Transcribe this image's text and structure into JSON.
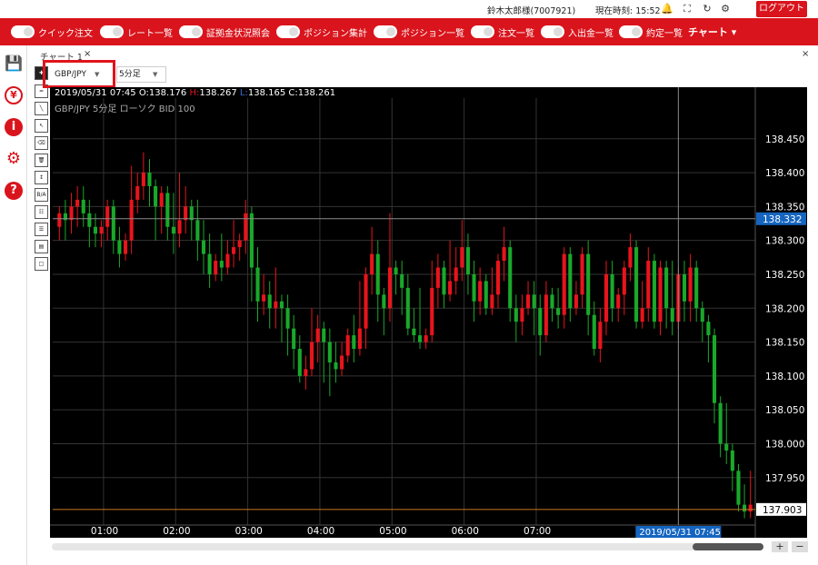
{
  "topbar": {
    "user": "鈴木太郎様(7007921)",
    "time_label": "現在時刻: 15:52",
    "logout": "ログアウト",
    "icons": [
      "bell-icon",
      "fullscreen-icon",
      "refresh-icon",
      "gear-icon"
    ]
  },
  "menu": {
    "items": [
      "クイック注文",
      "レート一覧",
      "証拠金状況照会",
      "ポジション集計",
      "ポジション一覧",
      "注文一覧",
      "入出金一覧",
      "約定一覧"
    ],
    "chart_label": "チャート"
  },
  "sidebar": {
    "icons": [
      "save-icon",
      "yen-icon",
      "info-icon",
      "gear-icon",
      "help-icon"
    ]
  },
  "panel": {
    "title": "チャート 1",
    "close": "×",
    "window_close": "×"
  },
  "controls": {
    "pair": "GBP/JPY",
    "timeframe": "5分足"
  },
  "ohlc": {
    "date": "2019/05/31",
    "time": "07:45",
    "open_label": "O:",
    "open": "138.176",
    "high_label": "H:",
    "high": "138.267",
    "low_label": "L:",
    "low": "138.165",
    "close_label": "C:",
    "close": "138.261"
  },
  "chart_info": "GBP/JPY  5分足  ローソク  BID  100",
  "crosshair": {
    "price": "138.332",
    "time": "2019/05/31 07:45"
  },
  "last_price": "137.903",
  "zoom": {
    "plus": "+",
    "minus": "−"
  },
  "chart_data": {
    "type": "candlestick",
    "y_ticks": [
      138.45,
      138.4,
      138.35,
      138.3,
      138.25,
      138.2,
      138.15,
      138.1,
      138.05,
      138.0,
      137.95
    ],
    "y_tick_labels": [
      "138.450",
      "138.400",
      "138.350",
      "138.300",
      "138.250",
      "138.200",
      "138.150",
      "138.100",
      "138.050",
      "138.000",
      "137.950"
    ],
    "x_ticks": [
      "01:00",
      "02:00",
      "03:00",
      "04:00",
      "05:00",
      "06:00",
      "07:00"
    ],
    "ylim": [
      137.88,
      138.51
    ],
    "colors": {
      "up": "#e8141c",
      "down": "#1aa82a",
      "grid": "#333333",
      "crosshair": "#8a8a8a",
      "last_line": "#c8781e",
      "crosshair_label_bg": "#1565c0"
    },
    "candles": [
      [
        138.32,
        138.34,
        138.3,
        138.35
      ],
      [
        138.34,
        138.33,
        138.3,
        138.36
      ],
      [
        138.33,
        138.35,
        138.31,
        138.37
      ],
      [
        138.35,
        138.36,
        138.32,
        138.38
      ],
      [
        138.36,
        138.34,
        138.32,
        138.38
      ],
      [
        138.34,
        138.32,
        138.29,
        138.36
      ],
      [
        138.32,
        138.31,
        138.29,
        138.34
      ],
      [
        138.31,
        138.32,
        138.29,
        138.33
      ],
      [
        138.32,
        138.35,
        138.3,
        138.36
      ],
      [
        138.35,
        138.3,
        138.28,
        138.36
      ],
      [
        138.3,
        138.28,
        138.26,
        138.32
      ],
      [
        138.28,
        138.3,
        138.27,
        138.31
      ],
      [
        138.3,
        138.36,
        138.28,
        138.41
      ],
      [
        138.36,
        138.38,
        138.34,
        138.4
      ],
      [
        138.38,
        138.4,
        138.36,
        138.43
      ],
      [
        138.4,
        138.38,
        138.35,
        138.42
      ],
      [
        138.38,
        138.35,
        138.3,
        138.39
      ],
      [
        138.35,
        138.37,
        138.31,
        138.38
      ],
      [
        138.37,
        138.32,
        138.3,
        138.38
      ],
      [
        138.32,
        138.31,
        138.28,
        138.37
      ],
      [
        138.31,
        138.33,
        138.29,
        138.4
      ],
      [
        138.33,
        138.35,
        138.31,
        138.38
      ],
      [
        138.35,
        138.33,
        138.3,
        138.36
      ],
      [
        138.33,
        138.3,
        138.27,
        138.36
      ],
      [
        138.3,
        138.28,
        138.25,
        138.33
      ],
      [
        138.28,
        138.25,
        138.23,
        138.31
      ],
      [
        138.25,
        138.27,
        138.24,
        138.28
      ],
      [
        138.27,
        138.26,
        138.24,
        138.31
      ],
      [
        138.26,
        138.28,
        138.25,
        138.3
      ],
      [
        138.28,
        138.29,
        138.26,
        138.33
      ],
      [
        138.29,
        138.3,
        138.27,
        138.31
      ],
      [
        138.3,
        138.34,
        138.28,
        138.36
      ],
      [
        138.34,
        138.26,
        138.21,
        138.35
      ],
      [
        138.26,
        138.21,
        138.18,
        138.29
      ],
      [
        138.21,
        138.22,
        138.19,
        138.25
      ],
      [
        138.22,
        138.2,
        138.17,
        138.24
      ],
      [
        138.2,
        138.21,
        138.17,
        138.26
      ],
      [
        138.21,
        138.2,
        138.15,
        138.22
      ],
      [
        138.2,
        138.17,
        138.13,
        138.22
      ],
      [
        138.17,
        138.14,
        138.11,
        138.19
      ],
      [
        138.14,
        138.1,
        138.09,
        138.16
      ],
      [
        138.1,
        138.11,
        138.08,
        138.13
      ],
      [
        138.11,
        138.15,
        138.1,
        138.2
      ],
      [
        138.15,
        138.17,
        138.12,
        138.19
      ],
      [
        138.17,
        138.15,
        138.09,
        138.18
      ],
      [
        138.15,
        138.12,
        138.07,
        138.17
      ],
      [
        138.12,
        138.11,
        138.09,
        138.15
      ],
      [
        138.11,
        138.13,
        138.1,
        138.15
      ],
      [
        138.13,
        138.16,
        138.12,
        138.17
      ],
      [
        138.16,
        138.14,
        138.12,
        138.19
      ],
      [
        138.14,
        138.17,
        138.13,
        138.24
      ],
      [
        138.17,
        138.25,
        138.14,
        138.26
      ],
      [
        138.25,
        138.28,
        138.22,
        138.32
      ],
      [
        138.28,
        138.22,
        138.18,
        138.3
      ],
      [
        138.22,
        138.2,
        138.16,
        138.23
      ],
      [
        138.2,
        138.26,
        138.18,
        138.34
      ],
      [
        138.26,
        138.25,
        138.22,
        138.27
      ],
      [
        138.25,
        138.23,
        138.19,
        138.27
      ],
      [
        138.23,
        138.17,
        138.16,
        138.25
      ],
      [
        138.17,
        138.16,
        138.15,
        138.2
      ],
      [
        138.16,
        138.15,
        138.14,
        138.23
      ],
      [
        138.15,
        138.16,
        138.14,
        138.17
      ],
      [
        138.16,
        138.23,
        138.15,
        138.27
      ],
      [
        138.23,
        138.26,
        138.2,
        138.28
      ],
      [
        138.26,
        138.22,
        138.2,
        138.27
      ],
      [
        138.22,
        138.24,
        138.21,
        138.3
      ],
      [
        138.24,
        138.26,
        138.22,
        138.29
      ],
      [
        138.26,
        138.29,
        138.24,
        138.33
      ],
      [
        138.29,
        138.25,
        138.22,
        138.31
      ],
      [
        138.25,
        138.21,
        138.18,
        138.27
      ],
      [
        138.21,
        138.24,
        138.19,
        138.26
      ],
      [
        138.24,
        138.2,
        138.19,
        138.25
      ],
      [
        138.2,
        138.22,
        138.19,
        138.26
      ],
      [
        138.22,
        138.27,
        138.2,
        138.28
      ],
      [
        138.27,
        138.29,
        138.24,
        138.32
      ],
      [
        138.29,
        138.2,
        138.18,
        138.3
      ],
      [
        138.2,
        138.18,
        138.15,
        138.22
      ],
      [
        138.18,
        138.2,
        138.16,
        138.22
      ],
      [
        138.2,
        138.22,
        138.19,
        138.24
      ],
      [
        138.22,
        138.2,
        138.16,
        138.24
      ],
      [
        138.2,
        138.16,
        138.13,
        138.22
      ],
      [
        138.16,
        138.22,
        138.15,
        138.24
      ],
      [
        138.22,
        138.2,
        138.18,
        138.23
      ],
      [
        138.2,
        138.19,
        138.17,
        138.23
      ],
      [
        138.19,
        138.28,
        138.17,
        138.29
      ],
      [
        138.28,
        138.2,
        138.18,
        138.29
      ],
      [
        138.2,
        138.22,
        138.19,
        138.24
      ],
      [
        138.22,
        138.28,
        138.2,
        138.29
      ],
      [
        138.28,
        138.19,
        138.16,
        138.3
      ],
      [
        138.19,
        138.14,
        138.13,
        138.21
      ],
      [
        138.14,
        138.18,
        138.12,
        138.2
      ],
      [
        138.18,
        138.25,
        138.16,
        138.27
      ],
      [
        138.25,
        138.2,
        138.18,
        138.27
      ],
      [
        138.2,
        138.22,
        138.18,
        138.23
      ],
      [
        138.22,
        138.26,
        138.19,
        138.27
      ],
      [
        138.26,
        138.29,
        138.24,
        138.31
      ],
      [
        138.29,
        138.18,
        138.17,
        138.3
      ],
      [
        138.18,
        138.2,
        138.17,
        138.24
      ],
      [
        138.2,
        138.27,
        138.18,
        138.29
      ],
      [
        138.27,
        138.18,
        138.17,
        138.28
      ],
      [
        138.18,
        138.26,
        138.16,
        138.27
      ],
      [
        138.26,
        138.2,
        138.17,
        138.27
      ],
      [
        138.2,
        138.18,
        138.16,
        138.27
      ],
      [
        138.18,
        138.25,
        138.17,
        138.26
      ],
      [
        138.25,
        138.21,
        138.18,
        138.27
      ],
      [
        138.21,
        138.26,
        138.18,
        138.28
      ],
      [
        138.26,
        138.2,
        138.18,
        138.27
      ],
      [
        138.2,
        138.18,
        138.15,
        138.21
      ],
      [
        138.18,
        138.16,
        138.12,
        138.19
      ],
      [
        138.16,
        138.06,
        138.03,
        138.17
      ],
      [
        138.06,
        138.0,
        137.98,
        138.07
      ],
      [
        138.0,
        137.99,
        137.97,
        138.06
      ],
      [
        137.99,
        137.96,
        137.93,
        138.0
      ],
      [
        137.96,
        137.91,
        137.9,
        137.97
      ],
      [
        137.91,
        137.9,
        137.89,
        137.94
      ],
      [
        137.9,
        137.91,
        137.89,
        137.96
      ]
    ]
  }
}
